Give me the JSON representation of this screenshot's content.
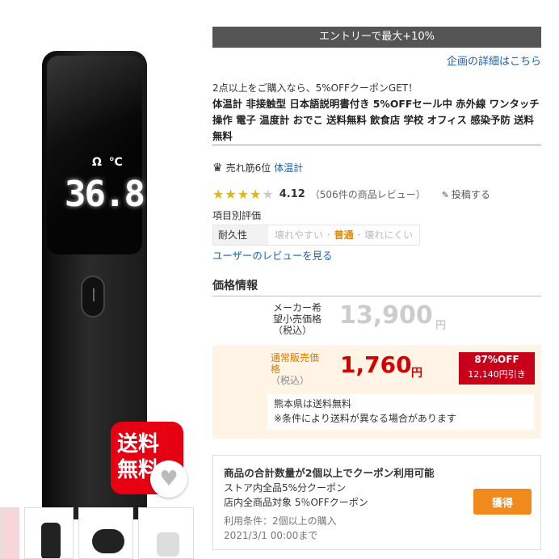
{
  "badge": {
    "line1": "送料",
    "line2": "無料"
  },
  "display": {
    "unit": "Ω ℃",
    "reading": "36.8"
  },
  "entry_bar": "エントリーで最大+10%",
  "detail_link": "企画の詳細はこちら",
  "promo": "2点以上をご購入なら、5%OFFクーポンGET！",
  "title": "体温計 非接触型 日本語説明書付き 5%OFFセール中 赤外線 ワンタッチ操作 電子 温度計 おでこ 送料無料 飲食店 学校 オフィス 感染予防 送料無料",
  "rank": {
    "text": "売れ筋6位",
    "link": "体温計"
  },
  "rating": {
    "stars": "★★★★",
    "empty": "★",
    "score": "4.12",
    "count": "（506件の商品レビュー）",
    "post": "投稿する"
  },
  "item_eval": {
    "label": "項目別評価",
    "head": "耐久性",
    "left": "壊れやすい",
    "mid": "普通",
    "right": "壊れにくい"
  },
  "user_reviews": "ユーザーのレビューを見る",
  "price": {
    "heading": "価格情報",
    "maker_label": "メーカー希望小売価格（税込）",
    "maker_price": "13,900",
    "maker_yen": "円",
    "sale_label": "通常販売価格",
    "sale_tax": "（税込）",
    "sale_price": "1,760",
    "sale_yen": "円",
    "discount_pct": "87%OFF",
    "discount_amount": "12,140円引き",
    "ship1": "熊本県は送料無料",
    "ship2": "※条件により送料が異なる場合があります"
  },
  "coupon": {
    "title": "商品の合計数量が2個以上でクーポン利用可能",
    "line1": "ストア内全品5%分クーポン",
    "line2": "店内全商品対象 5％OFFクーポン",
    "cond": "利用条件：2個以上の購入",
    "date": "2021/3/1 00:00まで",
    "button": "獲得"
  }
}
